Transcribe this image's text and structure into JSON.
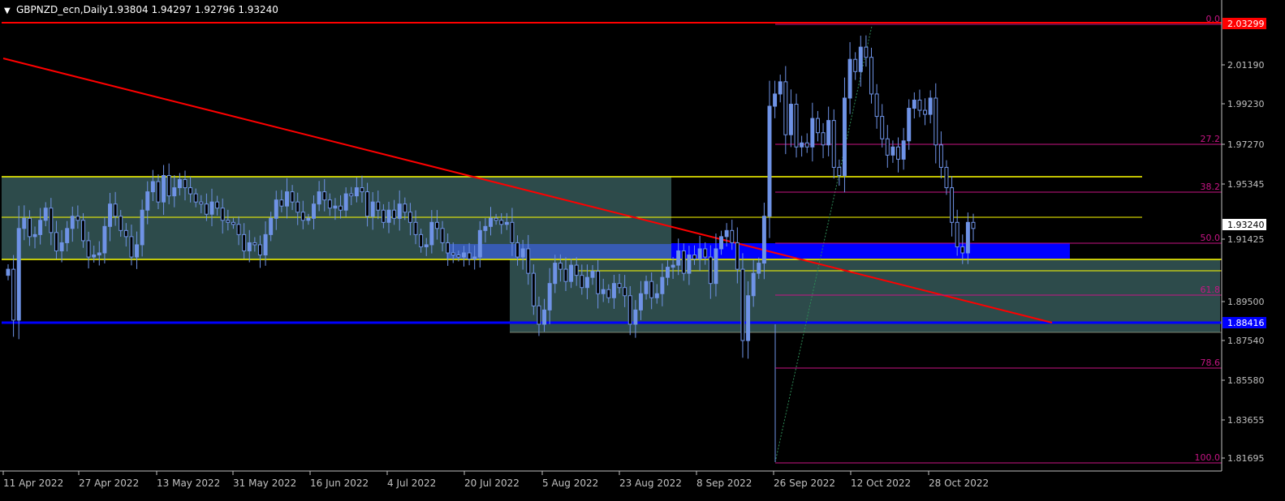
{
  "header": {
    "symbol_timeframe": "GBPNZD_ecn,Daily",
    "ohlc": "1.93804 1.94297 1.92796 1.93240",
    "menu_glyph": "▼"
  },
  "colors": {
    "background": "#000000",
    "bull": "#6f93e6",
    "bear": "#6f93e6",
    "zone_fill": "#2f4f4f",
    "blue_zone": "#0000ff",
    "red_line": "#ff0000",
    "yellow_line": "#ffff00",
    "fib_color": "#c71585",
    "axis_text": "#c0c0c0"
  },
  "price_axis": {
    "ticks": [
      "2.01190",
      "1.99230",
      "1.97270",
      "1.95345",
      "1.91425",
      "1.89500",
      "1.87540",
      "1.85580",
      "1.83655",
      "1.81695"
    ],
    "current_price_label": "1.93240",
    "red_level_label": "2.03299",
    "blue_level_label": "1.88416"
  },
  "time_axis": {
    "labels": [
      "11 Apr 2022",
      "27 Apr 2022",
      "13 May 2022",
      "31 May 2022",
      "16 Jun 2022",
      "4 Jul 2022",
      "20 Jul 2022",
      "5 Aug 2022",
      "23 Aug 2022",
      "8 Sep 2022",
      "26 Sep 2022",
      "12 Oct 2022",
      "28 Oct 2022"
    ]
  },
  "fibonacci": {
    "levels": [
      "0.0",
      "27.2",
      "38.2",
      "50.0",
      "61.8",
      "78.6",
      "100.0"
    ]
  },
  "horizontal_levels": {
    "red_resistance": 2.03299,
    "yellow_upper": 1.955,
    "yellow_mid": 1.9335,
    "yellow_lower": 1.9147,
    "blue_support": 1.88416
  },
  "chart_data": {
    "type": "candlestick",
    "symbol": "GBPNZD_ecn",
    "timeframe": "Daily",
    "ylim": [
      1.812,
      2.036
    ],
    "last": {
      "open": 1.93804,
      "high": 1.94297,
      "low": 1.92796,
      "close": 1.9324
    },
    "closes": [
      1.912,
      1.887,
      1.932,
      1.937,
      1.928,
      1.929,
      1.936,
      1.942,
      1.93,
      1.921,
      1.925,
      1.932,
      1.938,
      1.936,
      1.926,
      1.918,
      1.919,
      1.92,
      1.933,
      1.944,
      1.938,
      1.931,
      1.928,
      1.918,
      1.924,
      1.941,
      1.95,
      1.955,
      1.945,
      1.958,
      1.948,
      1.952,
      1.956,
      1.952,
      1.949,
      1.945,
      1.944,
      1.939,
      1.945,
      1.942,
      1.936,
      1.935,
      1.934,
      1.929,
      1.921,
      1.925,
      1.924,
      1.919,
      1.929,
      1.937,
      1.946,
      1.943,
      1.95,
      1.945,
      1.94,
      1.936,
      1.937,
      1.944,
      1.95,
      1.946,
      1.942,
      1.943,
      1.941,
      1.949,
      1.948,
      1.952,
      1.95,
      1.938,
      1.945,
      1.941,
      1.935,
      1.941,
      1.937,
      1.944,
      1.94,
      1.935,
      1.929,
      1.923,
      1.924,
      1.935,
      1.932,
      1.925,
      1.92,
      1.919,
      1.918,
      1.92,
      1.917,
      1.918,
      1.931,
      1.933,
      1.937,
      1.936,
      1.934,
      1.935,
      1.925,
      1.918,
      1.922,
      1.91,
      1.894,
      1.885,
      1.892,
      1.905,
      1.915,
      1.912,
      1.906,
      1.914,
      1.909,
      1.903,
      1.908,
      1.911,
      1.9,
      1.902,
      1.898,
      1.905,
      1.903,
      1.899,
      1.885,
      1.892,
      1.9,
      1.906,
      1.898,
      1.9,
      1.908,
      1.913,
      1.914,
      1.921,
      1.91,
      1.919,
      1.917,
      1.922,
      1.918,
      1.905,
      1.922,
      1.928,
      1.931,
      1.925,
      1.912,
      1.877,
      1.899,
      1.91,
      1.915,
      1.938,
      1.992,
      1.998,
      2.004,
      1.978,
      1.993,
      1.972,
      1.974,
      1.972,
      1.986,
      1.979,
      1.973,
      1.985,
      1.962,
      1.958,
      1.996,
      2.015,
      2.009,
      2.021,
      2.016,
      1.998,
      1.987,
      1.976,
      1.968,
      1.972,
      1.966,
      1.975,
      1.991,
      1.995,
      1.99,
      1.988,
      1.996,
      1.973,
      1.962,
      1.952,
      1.935,
      1.923,
      1.92,
      1.935,
      1.932
    ]
  }
}
